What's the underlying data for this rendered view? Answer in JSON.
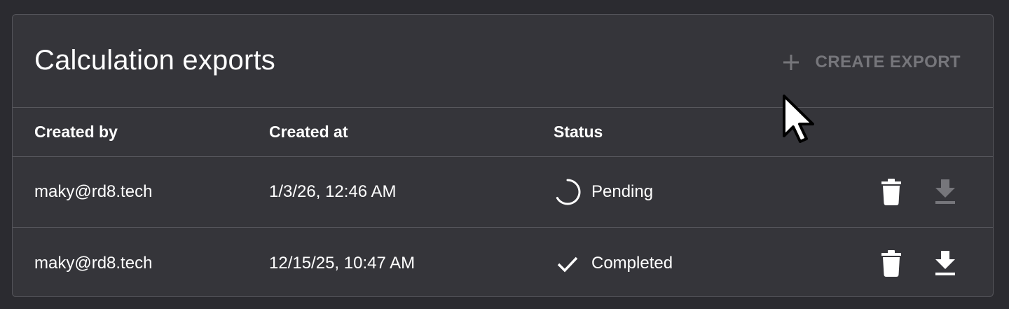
{
  "panel": {
    "title": "Calculation exports",
    "create_label": "CREATE EXPORT",
    "create_icon": "plus-icon"
  },
  "table": {
    "columns": [
      "Created by",
      "Created at",
      "Status"
    ],
    "rows": [
      {
        "created_by": "maky@rd8.tech",
        "created_at": "1/3/26, 12:46 AM",
        "status": "Pending",
        "status_icon": "spinner-icon",
        "download_enabled": false
      },
      {
        "created_by": "maky@rd8.tech",
        "created_at": "12/15/25, 10:47 AM",
        "status": "Completed",
        "status_icon": "check-icon",
        "download_enabled": true
      }
    ]
  },
  "colors": {
    "background": "#2b2b30",
    "card": "#35353a",
    "disabled": "#76767b",
    "text": "#ffffff"
  }
}
